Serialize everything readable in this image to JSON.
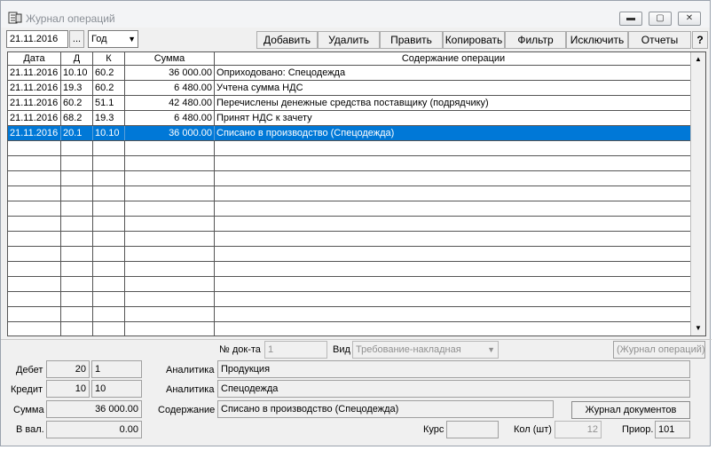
{
  "window": {
    "title": "Журнал операций"
  },
  "toolbar": {
    "date": "21.11.2016",
    "date_picker": "...",
    "period": "Год",
    "buttons": {
      "add": "Добавить",
      "delete": "Удалить",
      "edit": "Править",
      "copy": "Копировать",
      "filter": "Фильтр",
      "exclude": "Исключить",
      "reports": "Отчеты",
      "help": "?"
    }
  },
  "grid": {
    "columns": [
      "Дата",
      "Д",
      "К",
      "Сумма",
      "Содержание операции"
    ],
    "rows": [
      {
        "date": "21.11.2016",
        "debit": "10.10",
        "credit": "60.2",
        "amount": "36 000.00",
        "content": "Оприходовано: Спецодежда"
      },
      {
        "date": "21.11.2016",
        "debit": "19.3",
        "credit": "60.2",
        "amount": "6 480.00",
        "content": "Учтена сумма НДС"
      },
      {
        "date": "21.11.2016",
        "debit": "60.2",
        "credit": "51.1",
        "amount": "42 480.00",
        "content": "Перечислены денежные средства поставщику (подрядчику)"
      },
      {
        "date": "21.11.2016",
        "debit": "68.2",
        "credit": "19.3",
        "amount": "6 480.00",
        "content": "Принят НДС к зачету"
      },
      {
        "date": "21.11.2016",
        "debit": "20.1",
        "credit": "10.10",
        "amount": "36 000.00",
        "content": "Списано в производство (Спецодежда)"
      }
    ]
  },
  "details": {
    "doc_no_label": "№ док-та",
    "doc_no": "1",
    "kind_label": "Вид",
    "kind": "Требование-накладная",
    "journal_ops_button": "(Журнал операций)",
    "debit_label": "Дебет",
    "debit_acc": "20",
    "debit_sub": "1",
    "credit_label": "Кредит",
    "credit_acc": "10",
    "credit_sub": "10",
    "analytics_label": "Аналитика",
    "analytics1": "Продукция",
    "analytics2": "Спецодежда",
    "sum_label": "Сумма",
    "sum": "36 000.00",
    "content_label": "Содержание",
    "content": "Списано в производство (Спецодежда)",
    "journal_docs_button": "Журнал документов",
    "currency_label": "В вал.",
    "currency_value": "0.00",
    "rate_label": "Курс",
    "rate": "",
    "qty_label": "Кол (шт)",
    "qty": "12",
    "prior_label": "Приор.",
    "prior": "101"
  }
}
